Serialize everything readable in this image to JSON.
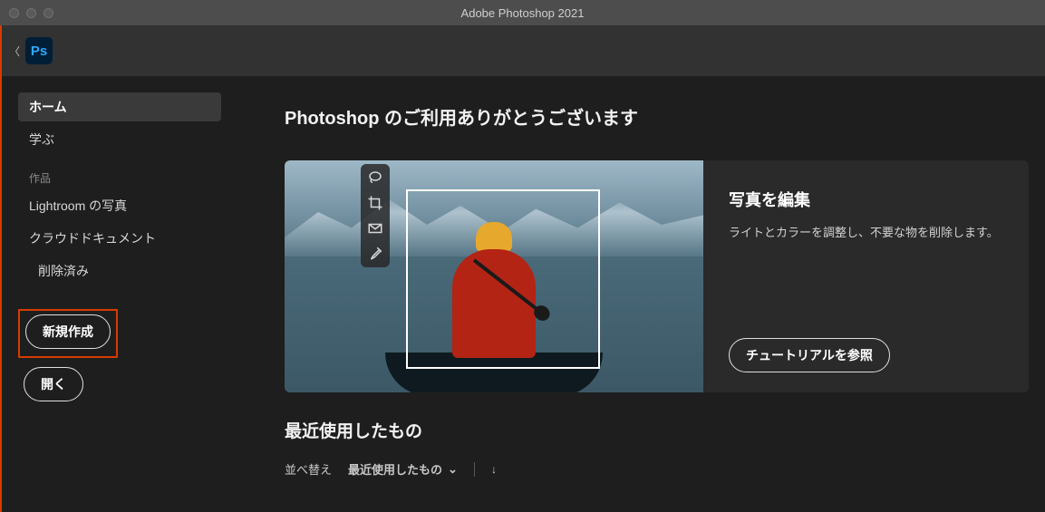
{
  "window": {
    "title": "Adobe Photoshop 2021"
  },
  "app_icon": {
    "text": "Ps"
  },
  "sidebar": {
    "home": "ホーム",
    "learn": "学ぶ",
    "section_works": "作品",
    "lightroom": "Lightroom の写真",
    "cloud_docs": "クラウドドキュメント",
    "deleted": "削除済み",
    "new_btn": "新規作成",
    "open_btn": "開く"
  },
  "content": {
    "welcome": "Photoshop のご利用ありがとうございます",
    "card": {
      "title": "写真を編集",
      "desc": "ライトとカラーを調整し、不要な物を削除します。",
      "cta": "チュートリアルを参照"
    },
    "recent": {
      "title": "最近使用したもの",
      "sort_label": "並べ替え",
      "sort_value": "最近使用したもの"
    }
  }
}
